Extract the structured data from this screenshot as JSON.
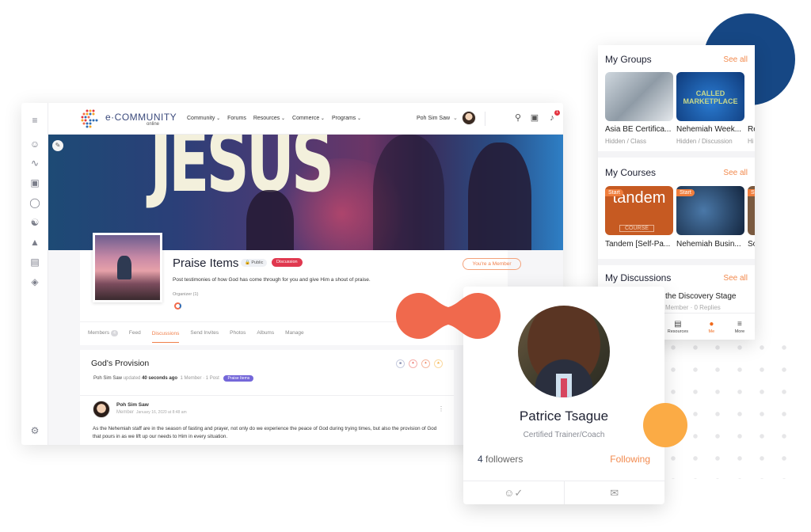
{
  "desktop": {
    "logo": {
      "name": "e·COMMUNITY",
      "sub": "online"
    },
    "nav": [
      {
        "label": "Community",
        "has_caret": true
      },
      {
        "label": "Forums",
        "has_caret": false
      },
      {
        "label": "Resources",
        "has_caret": true
      },
      {
        "label": "Commerce",
        "has_caret": true
      },
      {
        "label": "Programs",
        "has_caret": true
      }
    ],
    "user": {
      "name": "Poh Sim Saw",
      "notifications": "1"
    },
    "sidebar_icons": [
      "menu-icon",
      "user-icon",
      "activity-icon",
      "inbox-icon",
      "chat-icon",
      "groups-icon",
      "courses-icon",
      "briefcase-icon",
      "layers-icon",
      "settings-icon"
    ],
    "cover": {
      "word": "JESUS"
    },
    "group": {
      "title": "Praise Items",
      "visibility": "Public",
      "type": "Discussion",
      "description": "Post testimonies of how God has come through for you and give Him a shout of praise.",
      "organizer_label": "Organizer (1)",
      "member_button": "You're a Member"
    },
    "tabs": [
      {
        "label": "Members",
        "count": "4",
        "active": false
      },
      {
        "label": "Feed",
        "active": false
      },
      {
        "label": "Discussions",
        "active": true
      },
      {
        "label": "Send Invites",
        "active": false
      },
      {
        "label": "Photos",
        "active": false
      },
      {
        "label": "Albums",
        "active": false
      },
      {
        "label": "Manage",
        "active": false
      }
    ],
    "discussion": {
      "title": "God's Provision",
      "author": "Poh Sim Saw",
      "updated_word": "updated",
      "updated_time": "40 seconds ago",
      "stats": "1 Member · 1 Post",
      "tag": "Praise Items",
      "post": {
        "author": "Poh Sim Saw",
        "role": "Member",
        "date": "January 16, 2020 at 8:48 am",
        "body": "As the Nehemiah staff are in the season of fasting and prayer, not only do we experience the peace of God during trying times, but also the provision of God that pours in as we lift up our needs to Him in every situation."
      }
    }
  },
  "mobile": {
    "groups": {
      "heading": "My Groups",
      "see_all": "See all",
      "items": [
        {
          "title": "Asia BE Certifica...",
          "sub": "Hidden / Class"
        },
        {
          "title": "Nehemiah Week...",
          "sub": "Hidden / Discussion",
          "art_text": "CALLED MARKETPLACE"
        },
        {
          "title": "Re",
          "sub": "Hi"
        }
      ]
    },
    "courses": {
      "heading": "My Courses",
      "see_all": "See all",
      "start_label": "Start",
      "items": [
        {
          "title": "Tandem [Self-Pa...",
          "art_text": "tandem",
          "art_sub": "COURSE"
        },
        {
          "title": "Nehemiah Busin..."
        },
        {
          "title": "So"
        }
      ]
    },
    "discussions": {
      "heading": "My Discussions",
      "see_all": "See all",
      "item_title": "the Discovery Stage",
      "item_meta": "Member · 0 Replies"
    },
    "bottom_tabs": [
      {
        "label": "Resources",
        "icon": "books-icon",
        "active": false
      },
      {
        "label": "Me",
        "icon": "person-icon",
        "active": true
      },
      {
        "label": "More",
        "icon": "menu-icon",
        "active": false
      }
    ]
  },
  "profile": {
    "name": "Patrice Tsague",
    "role": "Certified Trainer/Coach",
    "followers_count": "4",
    "followers_label": "followers",
    "following_label": "Following"
  },
  "colors": {
    "accent_orange": "#f28a4e",
    "discussion_red": "#e0384f",
    "praise_purple": "#7467d9",
    "deco_blue": "#164784",
    "deco_yellow": "#fbab45",
    "deco_coral": "#f0694d"
  }
}
